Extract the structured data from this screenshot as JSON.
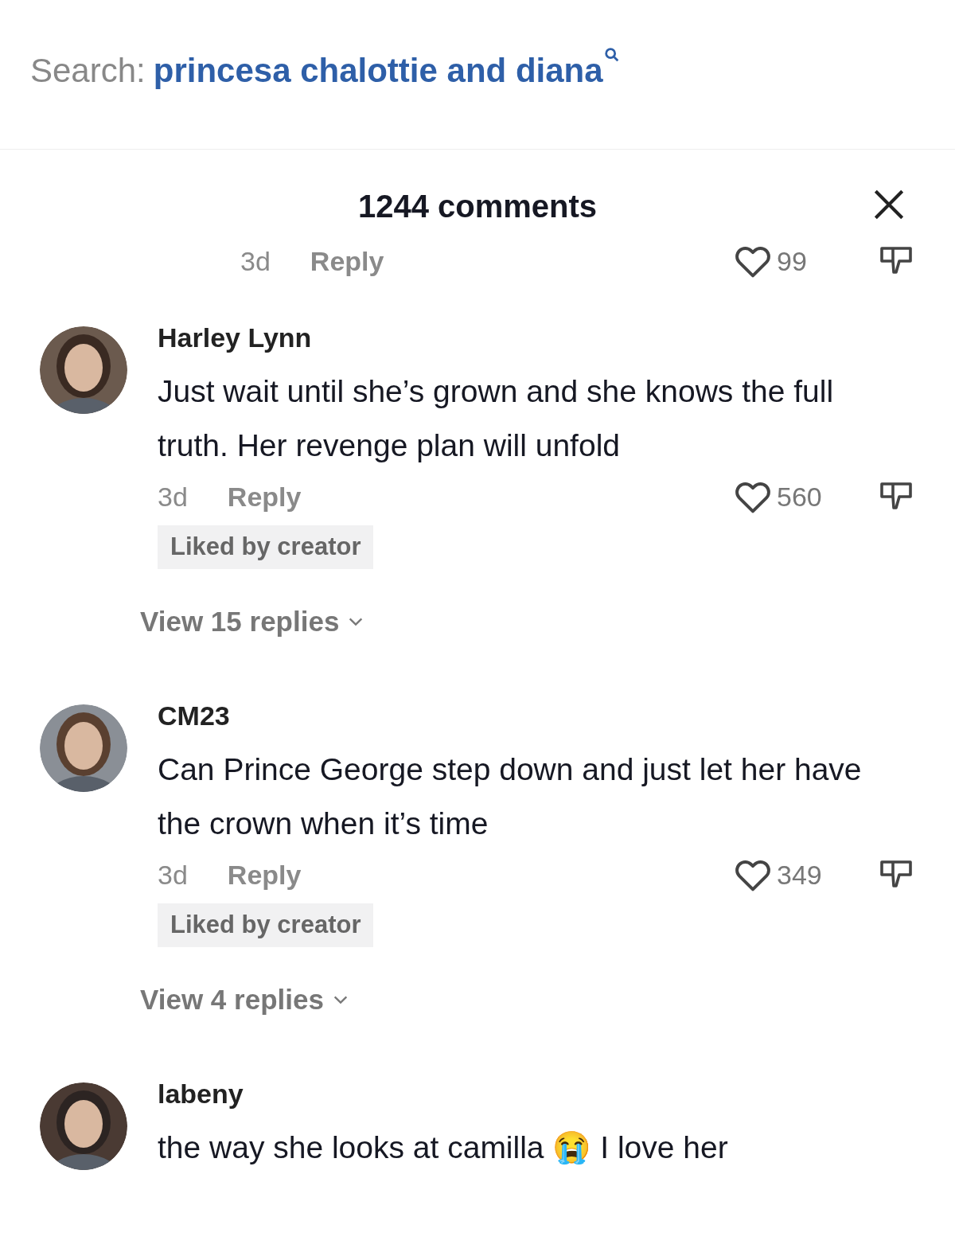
{
  "search": {
    "label": "Search:",
    "query": "princesa chalottie and diana"
  },
  "panel": {
    "title": "1244 comments"
  },
  "partial_row": {
    "age": "3d",
    "reply": "Reply",
    "likes": "99"
  },
  "comments": [
    {
      "author": "Harley Lynn",
      "text": "Just wait until she’s grown and she knows the full truth. Her revenge plan will unfold",
      "age": "3d",
      "reply": "Reply",
      "likes": "560",
      "badge": "Liked by creator",
      "replies": "View 15 replies"
    },
    {
      "author": "CM23",
      "text": "Can Prince George step down and just let her have the crown when it’s time",
      "age": "3d",
      "reply": "Reply",
      "likes": "349",
      "badge": "Liked by creator",
      "replies": "View 4 replies"
    },
    {
      "author": "labeny",
      "text": "the way she looks at camilla 😭 I love her"
    }
  ]
}
